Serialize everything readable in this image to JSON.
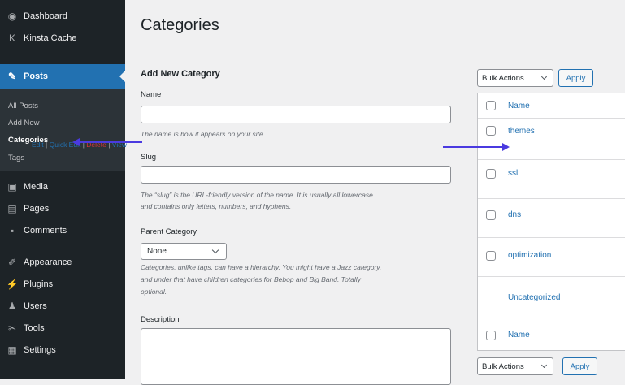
{
  "sidebar": {
    "items": [
      {
        "label": "Dashboard",
        "icon": "dashboard-icon",
        "glyph": "◉"
      },
      {
        "label": "Kinsta Cache",
        "icon": "kinsta-icon",
        "glyph": "K"
      },
      {
        "label": "Posts",
        "icon": "pin-icon",
        "glyph": "✎"
      },
      {
        "label": "Media",
        "icon": "media-icon",
        "glyph": "▣"
      },
      {
        "label": "Pages",
        "icon": "pages-icon",
        "glyph": "▤"
      },
      {
        "label": "Comments",
        "icon": "comment-icon",
        "glyph": "▪"
      },
      {
        "label": "Appearance",
        "icon": "brush-icon",
        "glyph": "✐"
      },
      {
        "label": "Plugins",
        "icon": "plugin-icon",
        "glyph": "⚡"
      },
      {
        "label": "Users",
        "icon": "user-icon",
        "glyph": "♟"
      },
      {
        "label": "Tools",
        "icon": "wrench-icon",
        "glyph": "✂"
      },
      {
        "label": "Settings",
        "icon": "settings-icon",
        "glyph": "▦"
      }
    ],
    "submenu": [
      "All Posts",
      "Add New",
      "Categories",
      "Tags"
    ]
  },
  "page_title": "Categories",
  "form": {
    "title": "Add New Category",
    "name_label": "Name",
    "name_help": "The name is how it appears on your site.",
    "slug_label": "Slug",
    "slug_help_1": "The “slug” is the URL-friendly version of the name. It is usually all lowercase",
    "slug_help_2": "and contains only letters, numbers, and hyphens.",
    "parent_label": "Parent Category",
    "parent_value": "None",
    "parent_help_1": "Categories, unlike tags, can have a hierarchy. You might have a Jazz category,",
    "parent_help_2": "and under that have children categories for Bebop and Big Band. Totally",
    "parent_help_3": "optional.",
    "description_label": "Description"
  },
  "list": {
    "bulk_label": "Bulk Actions",
    "apply_label": "Apply",
    "header_name": "Name",
    "footer_name": "Name",
    "rows": [
      "themes",
      "ssl",
      "dns",
      "optimization",
      "Uncategorized"
    ],
    "row_actions": {
      "edit": "Edit",
      "quick_edit": "Quick Edit",
      "delete": "Delete",
      "view": "View"
    }
  },
  "colors": {
    "accent": "#2271b1",
    "sidebar": "#1d2327",
    "annotation_arrow": "#4a3ae0"
  }
}
